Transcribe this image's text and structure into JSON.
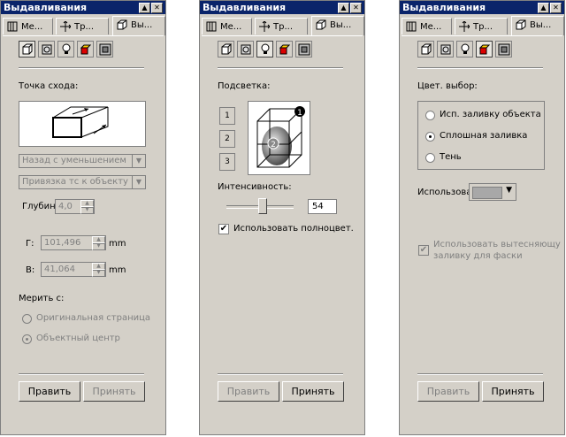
{
  "panels": [
    {
      "title": "Выдавливания",
      "tabs": [
        "Ме...",
        "Тр...",
        "Вы..."
      ],
      "section_label": "Точка схода:",
      "combo1": "Назад с уменьшением",
      "combo2": "Привязка тс к объекту",
      "depth_label": "Глубин",
      "depth_value": "4,0",
      "h_label": "Г:",
      "h_value": "101,496",
      "h_unit": "mm",
      "v_label": "В:",
      "v_value": "41,064",
      "v_unit": "mm",
      "measure_label": "Мерить с:",
      "radio1": "Оригинальная страница",
      "radio2": "Объектный центр",
      "btn_edit": "Править",
      "btn_apply": "Принять"
    },
    {
      "title": "Выдавливания",
      "tabs": [
        "Ме...",
        "Тр...",
        "Вы..."
      ],
      "section_label": "Подсветка:",
      "lights": [
        "1",
        "2",
        "3"
      ],
      "marker1": "1",
      "marker2": "2",
      "intensity_label": "Интенсивность:",
      "intensity_value": "54",
      "intensity_fraction": 0.54,
      "fullcolor_label": "Использовать полноцвет.",
      "btn_edit": "Править",
      "btn_apply": "Принять"
    },
    {
      "title": "Выдавливания",
      "tabs": [
        "Ме...",
        "Тр...",
        "Вы..."
      ],
      "section_label": "Цвет. выбор:",
      "radio1": "Исп. заливку объекта",
      "radio2": "Сплошная заливка",
      "radio3": "Тень",
      "use_label": "Использова",
      "use_color": "#a8a8a8",
      "bevel_label_1": "Использовать вытесняющу",
      "bevel_label_2": "заливку для фаски",
      "btn_edit": "Править",
      "btn_apply": "Принять"
    }
  ]
}
